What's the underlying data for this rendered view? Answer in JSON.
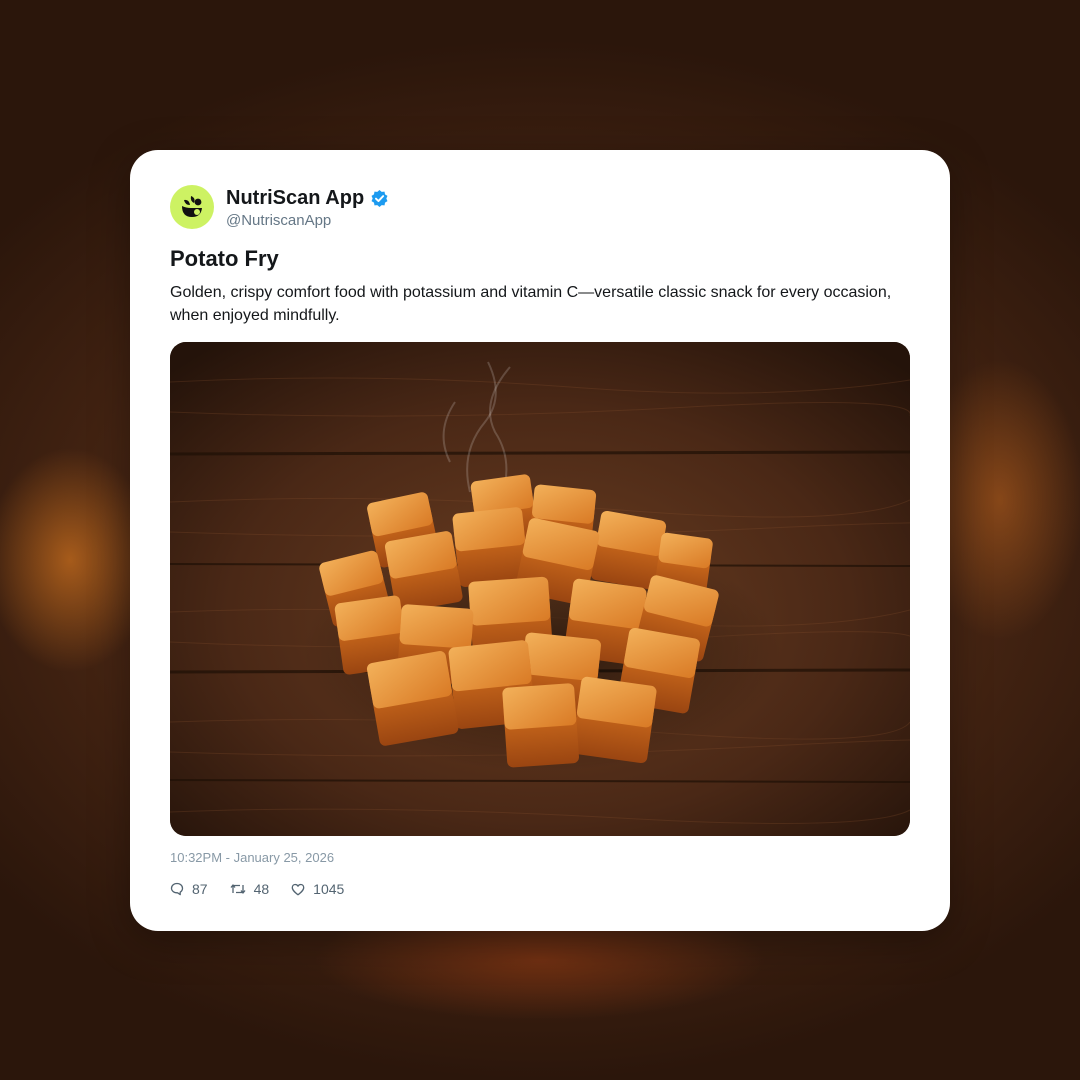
{
  "account": {
    "name": "NutriScan App",
    "handle": "@NutriscanApp",
    "verified": true,
    "avatar_icon": "leaf-bowl-logo-icon",
    "avatar_color": "#cdf263",
    "verified_color": "#1d9bf0"
  },
  "post": {
    "title": "Potato Fry",
    "description": "Golden, crispy comfort food with potassium and vitamin C—versatile classic snack for every occasion, when enjoyed mindfully.",
    "image_alt": "pile of crispy potato cubes on a rustic wooden table",
    "timestamp": "10:32PM - January 25, 2026"
  },
  "stats": {
    "replies": "87",
    "reposts": "48",
    "likes": "1045",
    "reply_icon": "comment-icon",
    "repost_icon": "repost-icon",
    "like_icon": "heart-icon"
  }
}
